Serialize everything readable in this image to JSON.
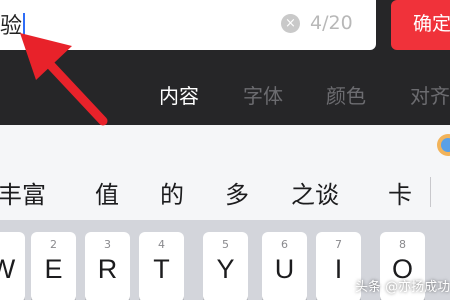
{
  "text_input": {
    "value": "验",
    "counter": "4/20"
  },
  "confirm_button": {
    "label": "确定"
  },
  "tabs": [
    {
      "label": "内容",
      "active": true
    },
    {
      "label": "字体",
      "active": false
    },
    {
      "label": "颜色",
      "active": false
    },
    {
      "label": "对齐",
      "active": false
    }
  ],
  "candidates": [
    "丰富",
    "值",
    "的",
    "多",
    "之谈",
    "卡"
  ],
  "keys": [
    {
      "digit": "",
      "letter": "W"
    },
    {
      "digit": "2",
      "letter": "E"
    },
    {
      "digit": "3",
      "letter": "R"
    },
    {
      "digit": "4",
      "letter": "T"
    },
    {
      "digit": "5",
      "letter": "Y"
    },
    {
      "digit": "6",
      "letter": "U"
    },
    {
      "digit": "7",
      "letter": "I"
    },
    {
      "digit": "8",
      "letter": "O"
    }
  ],
  "watermark": "头条 @亦扬成功",
  "colors": {
    "accent_red": "#f0323a",
    "caret_blue": "#2f6df6",
    "dark_bg": "#262628"
  }
}
